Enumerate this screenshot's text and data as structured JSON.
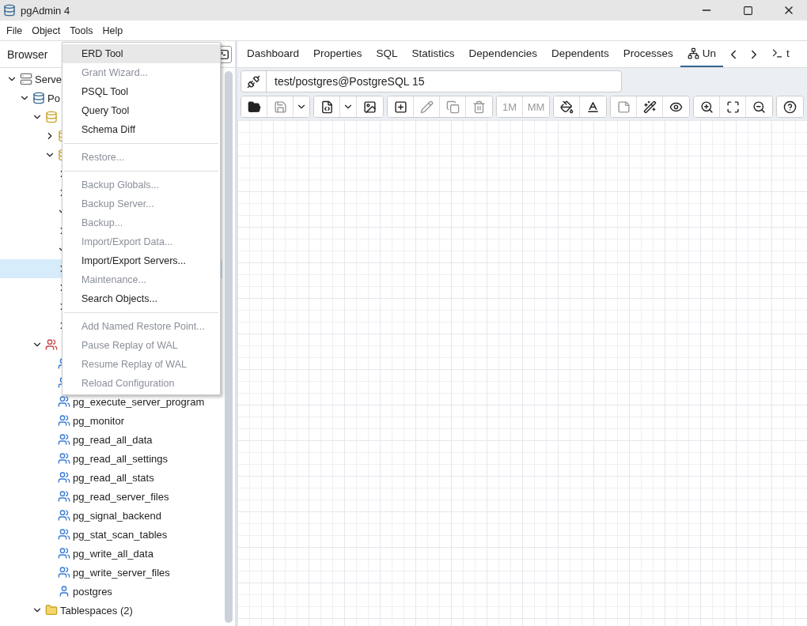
{
  "window": {
    "title": "pgAdmin 4"
  },
  "menubar": [
    "File",
    "Object",
    "Tools",
    "Help"
  ],
  "browser": {
    "title": "Browser"
  },
  "tree": [
    {
      "label": "Serve",
      "kind": "servers",
      "expanded": true,
      "selected": false,
      "children": [
        {
          "label": "Po",
          "kind": "server",
          "expanded": true,
          "selected": false,
          "children": [
            {
              "kind": "databases",
              "expanded": true,
              "selected": false,
              "children": [
                {
                  "kind": "database",
                  "expanded": false,
                  "selected": false
                },
                {
                  "kind": "database",
                  "expanded": true,
                  "selected": false,
                  "children": [
                    {
                      "expanded": false,
                      "selected": false
                    },
                    {
                      "expanded": false,
                      "selected": false
                    },
                    {
                      "expanded": true,
                      "selected": false
                    },
                    {
                      "expanded": false,
                      "selected": false
                    },
                    {
                      "expanded": true,
                      "selected": false
                    },
                    {
                      "expanded": false,
                      "selected": true
                    },
                    {
                      "expanded": false,
                      "selected": false
                    },
                    {
                      "expanded": false,
                      "selected": false
                    },
                    {
                      "expanded": false,
                      "selected": false
                    }
                  ]
                }
              ]
            },
            {
              "kind": "roles",
              "expanded": true,
              "selected": false,
              "children": [
                {
                  "kind": "group-role",
                  "selected": false
                },
                {
                  "kind": "group-role",
                  "selected": false
                },
                {
                  "label": "pg_execute_server_program",
                  "kind": "group-role",
                  "selected": false
                },
                {
                  "label": "pg_monitor",
                  "kind": "group-role",
                  "selected": false
                },
                {
                  "label": "pg_read_all_data",
                  "kind": "group-role",
                  "selected": false
                },
                {
                  "label": "pg_read_all_settings",
                  "kind": "group-role",
                  "selected": false
                },
                {
                  "label": "pg_read_all_stats",
                  "kind": "group-role",
                  "selected": false
                },
                {
                  "label": "pg_read_server_files",
                  "kind": "group-role",
                  "selected": false
                },
                {
                  "label": "pg_signal_backend",
                  "kind": "group-role",
                  "selected": false
                },
                {
                  "label": "pg_stat_scan_tables",
                  "kind": "group-role",
                  "selected": false
                },
                {
                  "label": "pg_write_all_data",
                  "kind": "group-role",
                  "selected": false
                },
                {
                  "label": "pg_write_server_files",
                  "kind": "group-role",
                  "selected": false
                },
                {
                  "label": "postgres",
                  "kind": "user-role",
                  "selected": false
                }
              ]
            },
            {
              "label": "Tablespaces (2)",
              "kind": "tablespaces",
              "expanded": true,
              "selected": false
            }
          ]
        }
      ]
    }
  ],
  "tools_menu": [
    {
      "kind": "item",
      "label": "ERD Tool",
      "disabled": false,
      "selected": true
    },
    {
      "kind": "item",
      "label": "Grant Wizard...",
      "disabled": true,
      "selected": false
    },
    {
      "kind": "item",
      "label": "PSQL Tool",
      "disabled": false,
      "selected": false
    },
    {
      "kind": "item",
      "label": "Query Tool",
      "disabled": false,
      "selected": false
    },
    {
      "kind": "item",
      "label": "Schema Diff",
      "disabled": false,
      "selected": false
    },
    {
      "kind": "separator"
    },
    {
      "kind": "item",
      "label": "Restore...",
      "disabled": true,
      "selected": false
    },
    {
      "kind": "separator"
    },
    {
      "kind": "item",
      "label": "Backup Globals...",
      "disabled": true,
      "selected": false
    },
    {
      "kind": "item",
      "label": "Backup Server...",
      "disabled": true,
      "selected": false
    },
    {
      "kind": "item",
      "label": "Backup...",
      "disabled": true,
      "selected": false
    },
    {
      "kind": "item",
      "label": "Import/Export Data...",
      "disabled": true,
      "selected": false
    },
    {
      "kind": "item",
      "label": "Import/Export Servers...",
      "disabled": false,
      "selected": false
    },
    {
      "kind": "item",
      "label": "Maintenance...",
      "disabled": true,
      "selected": false
    },
    {
      "kind": "item",
      "label": "Search Objects...",
      "disabled": false,
      "selected": false
    },
    {
      "kind": "separator"
    },
    {
      "kind": "item",
      "label": "Add Named Restore Point...",
      "disabled": true,
      "selected": false
    },
    {
      "kind": "item",
      "label": "Pause Replay of WAL",
      "disabled": true,
      "selected": false
    },
    {
      "kind": "item",
      "label": "Resume Replay of WAL",
      "disabled": true,
      "selected": false
    },
    {
      "kind": "item",
      "label": "Reload Configuration",
      "disabled": true,
      "selected": false
    }
  ],
  "tabs": [
    {
      "label": "Dashboard",
      "kind": "plain",
      "selected": false
    },
    {
      "label": "Properties",
      "kind": "plain",
      "selected": false
    },
    {
      "label": "SQL",
      "kind": "plain",
      "selected": false
    },
    {
      "label": "Statistics",
      "kind": "plain",
      "selected": false
    },
    {
      "label": "Dependencies",
      "kind": "plain",
      "selected": false
    },
    {
      "label": "Dependents",
      "kind": "plain",
      "selected": false
    },
    {
      "label": "Processes",
      "kind": "plain",
      "selected": false
    },
    {
      "label": "Un",
      "kind": "erd",
      "selected": true
    },
    {
      "label": "t",
      "kind": "psql",
      "selected": false
    }
  ],
  "connection": {
    "value": "test/postgres@PostgreSQL 15"
  },
  "toolbar": [
    [
      {
        "kind": "open",
        "disabled": false
      },
      {
        "kind": "save",
        "disabled": true
      },
      {
        "kind": "caret",
        "disabled": false
      }
    ],
    [
      {
        "kind": "sql",
        "disabled": false
      },
      {
        "kind": "caret",
        "disabled": false
      },
      {
        "kind": "image",
        "disabled": false
      }
    ],
    [
      {
        "kind": "add",
        "disabled": false
      },
      {
        "kind": "edit",
        "disabled": true
      },
      {
        "kind": "clone",
        "disabled": true
      },
      {
        "kind": "delete",
        "disabled": true
      }
    ],
    [
      {
        "kind": "text",
        "label": "1M",
        "disabled": true
      },
      {
        "kind": "text",
        "label": "MM",
        "disabled": true
      }
    ],
    [
      {
        "kind": "fill",
        "disabled": false
      },
      {
        "kind": "font",
        "disabled": false
      }
    ],
    [
      {
        "kind": "note",
        "disabled": true
      },
      {
        "kind": "auto",
        "disabled": false
      },
      {
        "kind": "eye",
        "disabled": false
      }
    ],
    [
      {
        "kind": "zoom-in",
        "disabled": false
      },
      {
        "kind": "fit",
        "disabled": false
      },
      {
        "kind": "zoom-out",
        "disabled": false
      }
    ],
    [
      {
        "kind": "help",
        "disabled": false
      }
    ]
  ]
}
